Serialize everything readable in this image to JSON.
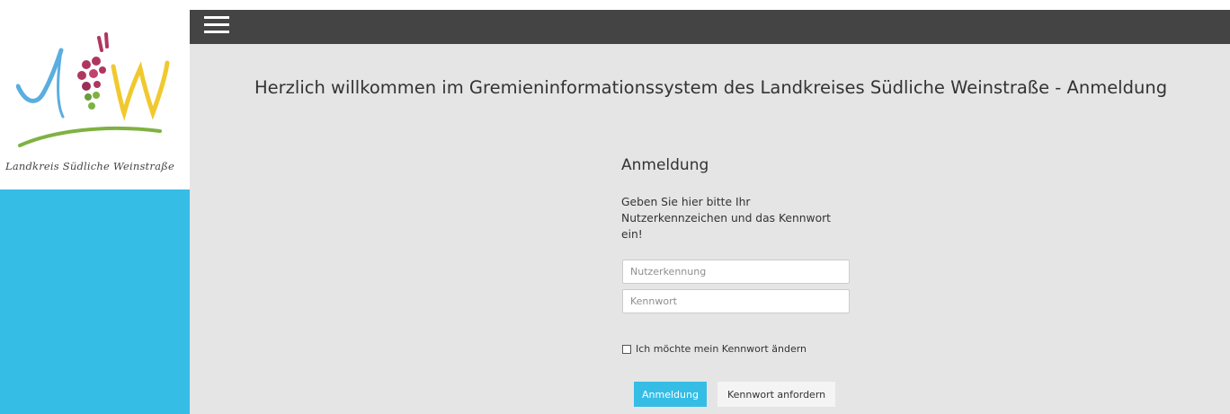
{
  "logo": {
    "caption": "Landkreis Südliche Weinstraße",
    "icon": "landkreis-logo"
  },
  "topbar": {
    "menu_icon": "hamburger-menu-icon"
  },
  "main": {
    "title": "Herzlich willkommen im Gremieninformationssystem des Landkreises Südliche Weinstraße - Anmeldung"
  },
  "login": {
    "heading": "Anmeldung",
    "instruction": "Geben Sie hier bitte Ihr Nutzerkennzeichen und das Kennwort ein!",
    "username_placeholder": "Nutzerkennung",
    "username_value": "",
    "password_placeholder": "Kennwort",
    "password_value": "",
    "change_password_label": "Ich möchte mein Kennwort ändern",
    "change_password_checked": false,
    "submit_label": "Anmeldung",
    "request_password_label": "Kennwort anfordern"
  },
  "colors": {
    "accent": "#35bde6",
    "topbar": "#444444",
    "content_bg": "#e5e5e5"
  }
}
